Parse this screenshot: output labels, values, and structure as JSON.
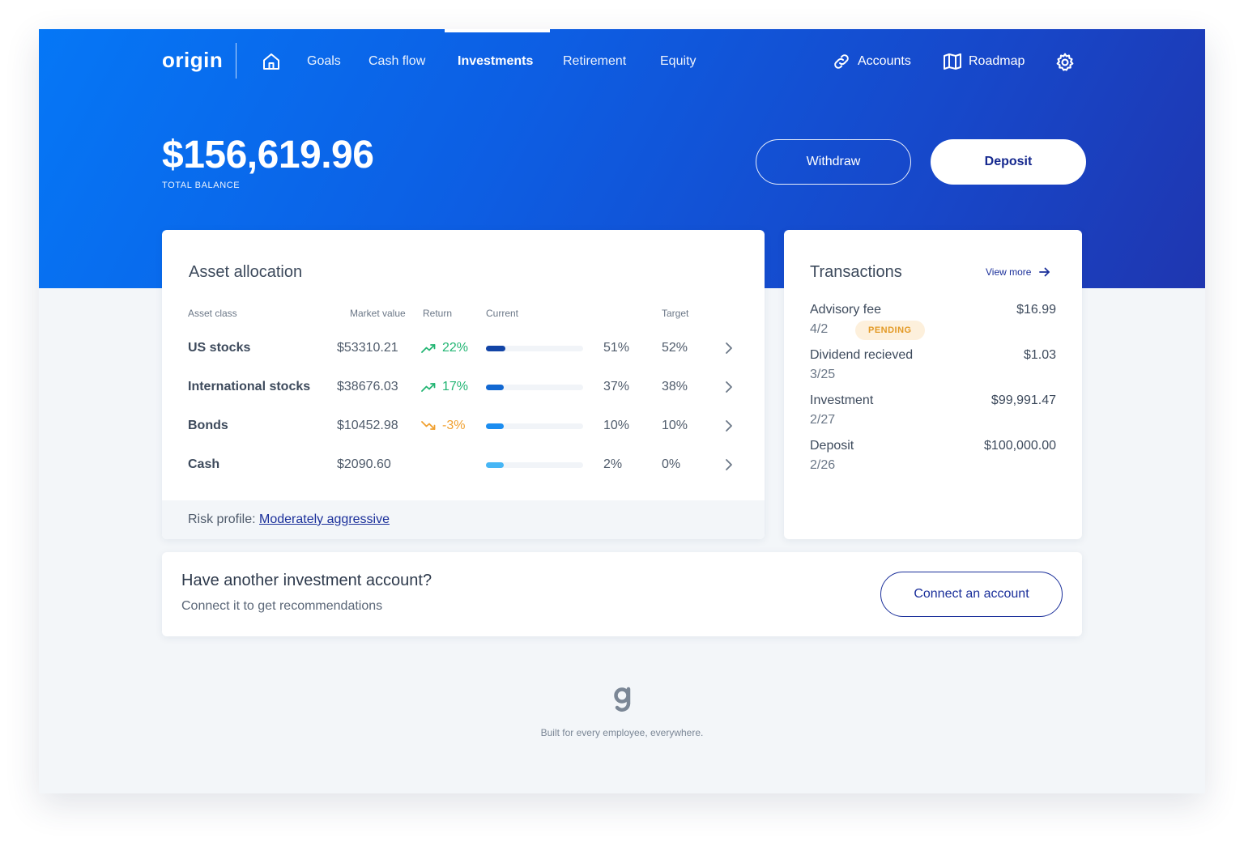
{
  "colors": {
    "hero_start": "#0577f6",
    "hero_end": "#1f36b0",
    "accent_dark": "#1a2f9a",
    "positive": "#22b573",
    "negative": "#f0a030",
    "pending_bg": "#fdf0dc"
  },
  "nav": {
    "logo": "origin",
    "home_icon": "home-icon",
    "links": [
      "Goals",
      "Cash flow",
      "Investments",
      "Retirement",
      "Equity"
    ],
    "active": "Investments",
    "accounts": "Accounts",
    "roadmap": "Roadmap",
    "settings_icon": "gear-icon"
  },
  "balance": {
    "amount": "$156,619.96",
    "label": "TOTAL BALANCE"
  },
  "actions": {
    "withdraw": "Withdraw",
    "deposit": "Deposit"
  },
  "asset_allocation": {
    "title": "Asset allocation",
    "headers": {
      "asset_class": "Asset class",
      "market_value": "Market value",
      "return": "Return",
      "current": "Current",
      "target": "Target"
    },
    "rows": [
      {
        "name": "US stocks",
        "value": "$53310.21",
        "return": "22%",
        "trend": "up",
        "current": "51%",
        "current_pct": 51,
        "target": "52%",
        "bar_color": "#1244a6"
      },
      {
        "name": "International stocks",
        "value": "$38676.03",
        "return": "17%",
        "trend": "up",
        "current": "37%",
        "current_pct": 37,
        "target": "38%",
        "bar_color": "#1268d2"
      },
      {
        "name": "Bonds",
        "value": "$10452.98",
        "return": "-3%",
        "trend": "down",
        "current": "10%",
        "current_pct": 10,
        "target": "10%",
        "bar_color": "#1c8df0"
      },
      {
        "name": "Cash",
        "value": "$2090.60",
        "return": "",
        "trend": "none",
        "current": "2%",
        "current_pct": 2,
        "target": "0%",
        "bar_color": "#47b6f5"
      }
    ],
    "risk_label": "Risk profile:",
    "risk_value": "Moderately aggressive"
  },
  "transactions": {
    "title": "Transactions",
    "view_more": "View more",
    "items": [
      {
        "name": "Advisory fee",
        "amount": "$16.99",
        "date": "4/2",
        "badge": "PENDING"
      },
      {
        "name": "Dividend recieved",
        "amount": "$1.03",
        "date": "3/25",
        "badge": ""
      },
      {
        "name": "Investment",
        "amount": "$99,991.47",
        "date": "2/27",
        "badge": ""
      },
      {
        "name": "Deposit",
        "amount": "$100,000.00",
        "date": "2/26",
        "badge": ""
      }
    ]
  },
  "connect": {
    "title": "Have another investment account?",
    "subtitle": "Connect it to get recommendations",
    "button": "Connect an account"
  },
  "footer": {
    "logo_icon": "g-logo-icon",
    "tagline": "Built for every employee, everywhere."
  }
}
